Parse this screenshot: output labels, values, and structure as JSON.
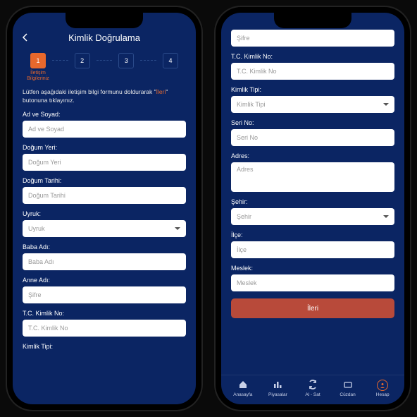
{
  "phone1": {
    "title": "Kimlik Doğrulama",
    "stepper": {
      "s1": "1",
      "s2": "2",
      "s3": "3",
      "s4": "4",
      "label1a": "İletişim",
      "label1b": "Bilgileriniz"
    },
    "instructions_pre": "Lütfen aşağıdaki iletişim bilgi formunu doldurarak \"",
    "instructions_hl": "İleri",
    "instructions_post": "\" butonuna tıklayınız.",
    "f_adsoyad_label": "Ad ve Soyad:",
    "f_adsoyad_ph": "Ad ve Soyad",
    "f_dogyer_label": "Doğum Yeri:",
    "f_dogyer_ph": "Doğum Yeri",
    "f_dogtar_label": "Doğum Tarihi:",
    "f_dogtar_ph": "Doğum Tarihi",
    "f_uyruk_label": "Uyruk:",
    "f_uyruk_ph": "Uyruk",
    "f_baba_label": "Baba Adı:",
    "f_baba_ph": "Baba Adı",
    "f_anne_label": "Anne Adı:",
    "f_anne_ph": "Şifre",
    "f_tc_label": "T.C. Kimlik No:",
    "f_tc_ph": "T.C. Kimlik No",
    "f_kimtipi_label": "Kimlik Tipi:"
  },
  "phone2": {
    "f_sifre_ph": "Şifre",
    "f_tc_label": "T.C. Kimlik No:",
    "f_tc_ph": "T.C. Kimlik No",
    "f_kimtipi_label": "Kimlik Tipi:",
    "f_kimtipi_ph": "Kimlik Tipi",
    "f_seri_label": "Seri No:",
    "f_seri_ph": "Seri No",
    "f_adres_label": "Adres:",
    "f_adres_ph": "Adres",
    "f_sehir_label": "Şehir:",
    "f_sehir_ph": "Şehir",
    "f_ilce_label": "İlçe:",
    "f_ilce_ph": "İlçe",
    "f_meslek_label": "Meslek:",
    "f_meslek_ph": "Meslek",
    "btn": "İleri",
    "nav_home": "Anasayfa",
    "nav_markets": "Piyasalar",
    "nav_trade": "Al - Sat",
    "nav_wallet": "Cüzdan",
    "nav_account": "Hesap"
  }
}
